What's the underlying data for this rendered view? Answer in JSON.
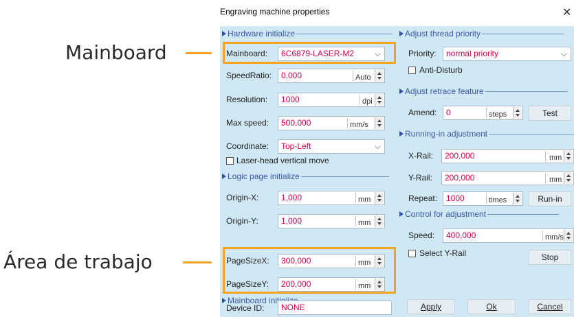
{
  "annotations": {
    "mainboard": "Mainboard",
    "work_area": "Área de trabajo"
  },
  "colors": {
    "highlight": "#f3a51d",
    "panel_bg": "#cfe8f4",
    "value_text": "#d4004a"
  },
  "dialog": {
    "title": "Engraving machine properties",
    "close_icon": "close-icon",
    "hardware": {
      "section": "Hardware initialize",
      "mainboard_label": "Mainboard:",
      "mainboard_value": "6C6879-LASER-M2",
      "speedratio_label": "SpeedRatio:",
      "speedratio_value": "0,000",
      "speedratio_unit": "Auto",
      "resolution_label": "Resolution:",
      "resolution_value": "1000",
      "resolution_unit": "dpi",
      "maxspeed_label": "Max speed:",
      "maxspeed_value": "500,000",
      "maxspeed_unit": "mm/s",
      "coordinate_label": "Coordinate:",
      "coordinate_value": "Top-Left",
      "vertical_move_label": "Laser-head vertical move"
    },
    "logic": {
      "section": "Logic page initialize",
      "originx_label": "Origin-X:",
      "originx_value": "1,000",
      "originx_unit": "mm",
      "originy_label": "Origin-Y:",
      "originy_value": "1,000",
      "originy_unit": "mm",
      "pagesizex_label": "PageSizeX:",
      "pagesizex_value": "300,000",
      "pagesizex_unit": "mm",
      "pagesizey_label": "PageSizeY:",
      "pagesizey_value": "200,000",
      "pagesizey_unit": "mm"
    },
    "mainboard_init": {
      "section": "Mainboard initialize",
      "device_label": "Device ID:",
      "device_value": "NONE"
    },
    "thread": {
      "section": "Adjust thread priority",
      "priority_label": "Priority:",
      "priority_value": "normal priority",
      "anti_disturb_label": "Anti-Disturb"
    },
    "retrace": {
      "section": "Adjust retrace feature",
      "amend_label": "Amend:",
      "amend_value": "0",
      "amend_unit": "steps",
      "test_button": "Test"
    },
    "running": {
      "section": "Running-in adjustment",
      "xrail_label": "X-Rail:",
      "xrail_value": "200,000",
      "xrail_unit": "mm",
      "yrail_label": "Y-Rail:",
      "yrail_value": "200,000",
      "yrail_unit": "mm",
      "repeat_label": "Repeat:",
      "repeat_value": "1000",
      "repeat_unit": "times",
      "runin_button": "Run-in"
    },
    "control": {
      "section": "Control for adjustment",
      "speed_label": "Speed:",
      "speed_value": "400,000",
      "speed_unit": "mm/s",
      "select_yrail_label": "Select Y-Rail",
      "stop_button": "Stop"
    },
    "footer": {
      "apply": "Apply",
      "ok": "Ok",
      "cancel": "Cancel"
    }
  }
}
